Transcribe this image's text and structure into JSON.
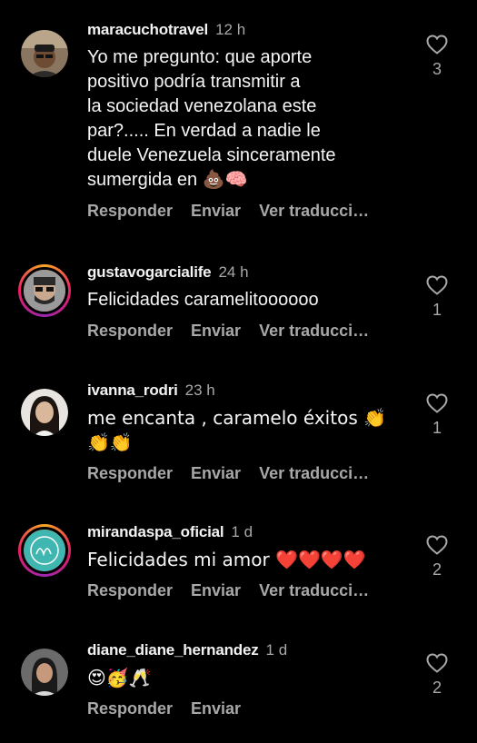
{
  "comments": [
    {
      "username": "maracuchotravel",
      "time": "12 h",
      "text": "Yo me pregunto: que aporte\npositivo podría transmitir a\nla sociedad venezolana este\npar?..... En verdad a nadie le\nduele Venezuela sinceramente\nsumergida en 💩🧠",
      "actions": [
        "Responder",
        "Enviar",
        "Ver traducci…"
      ],
      "likes": "3"
    },
    {
      "username": "gustavogarcialife",
      "time": "24 h",
      "text": "Felicidades caramelitoooooo",
      "actions": [
        "Responder",
        "Enviar",
        "Ver traducci…"
      ],
      "likes": "1"
    },
    {
      "username": "ivanna_rodri",
      "time": "23 h",
      "text": "me encanta , caramelo éxitos 👏\n👏👏",
      "actions": [
        "Responder",
        "Enviar",
        "Ver traducci…"
      ],
      "likes": "1"
    },
    {
      "username": "mirandaspa_oficial",
      "time": "1 d",
      "text": "Felicidades mi amor ❤️❤️❤️❤️",
      "actions": [
        "Responder",
        "Enviar",
        "Ver traducci…"
      ],
      "likes": "2"
    },
    {
      "username": "diane_diane_hernandez",
      "time": "1 d",
      "text": "😍🥳🥂",
      "actions": [
        "Responder",
        "Enviar"
      ],
      "likes": "2"
    }
  ],
  "icons": {
    "like": "heart-outline-icon"
  },
  "colors": {
    "background": "#000000",
    "secondary_text": "#a8a8a8",
    "primary_text": "#f5f5f5"
  }
}
